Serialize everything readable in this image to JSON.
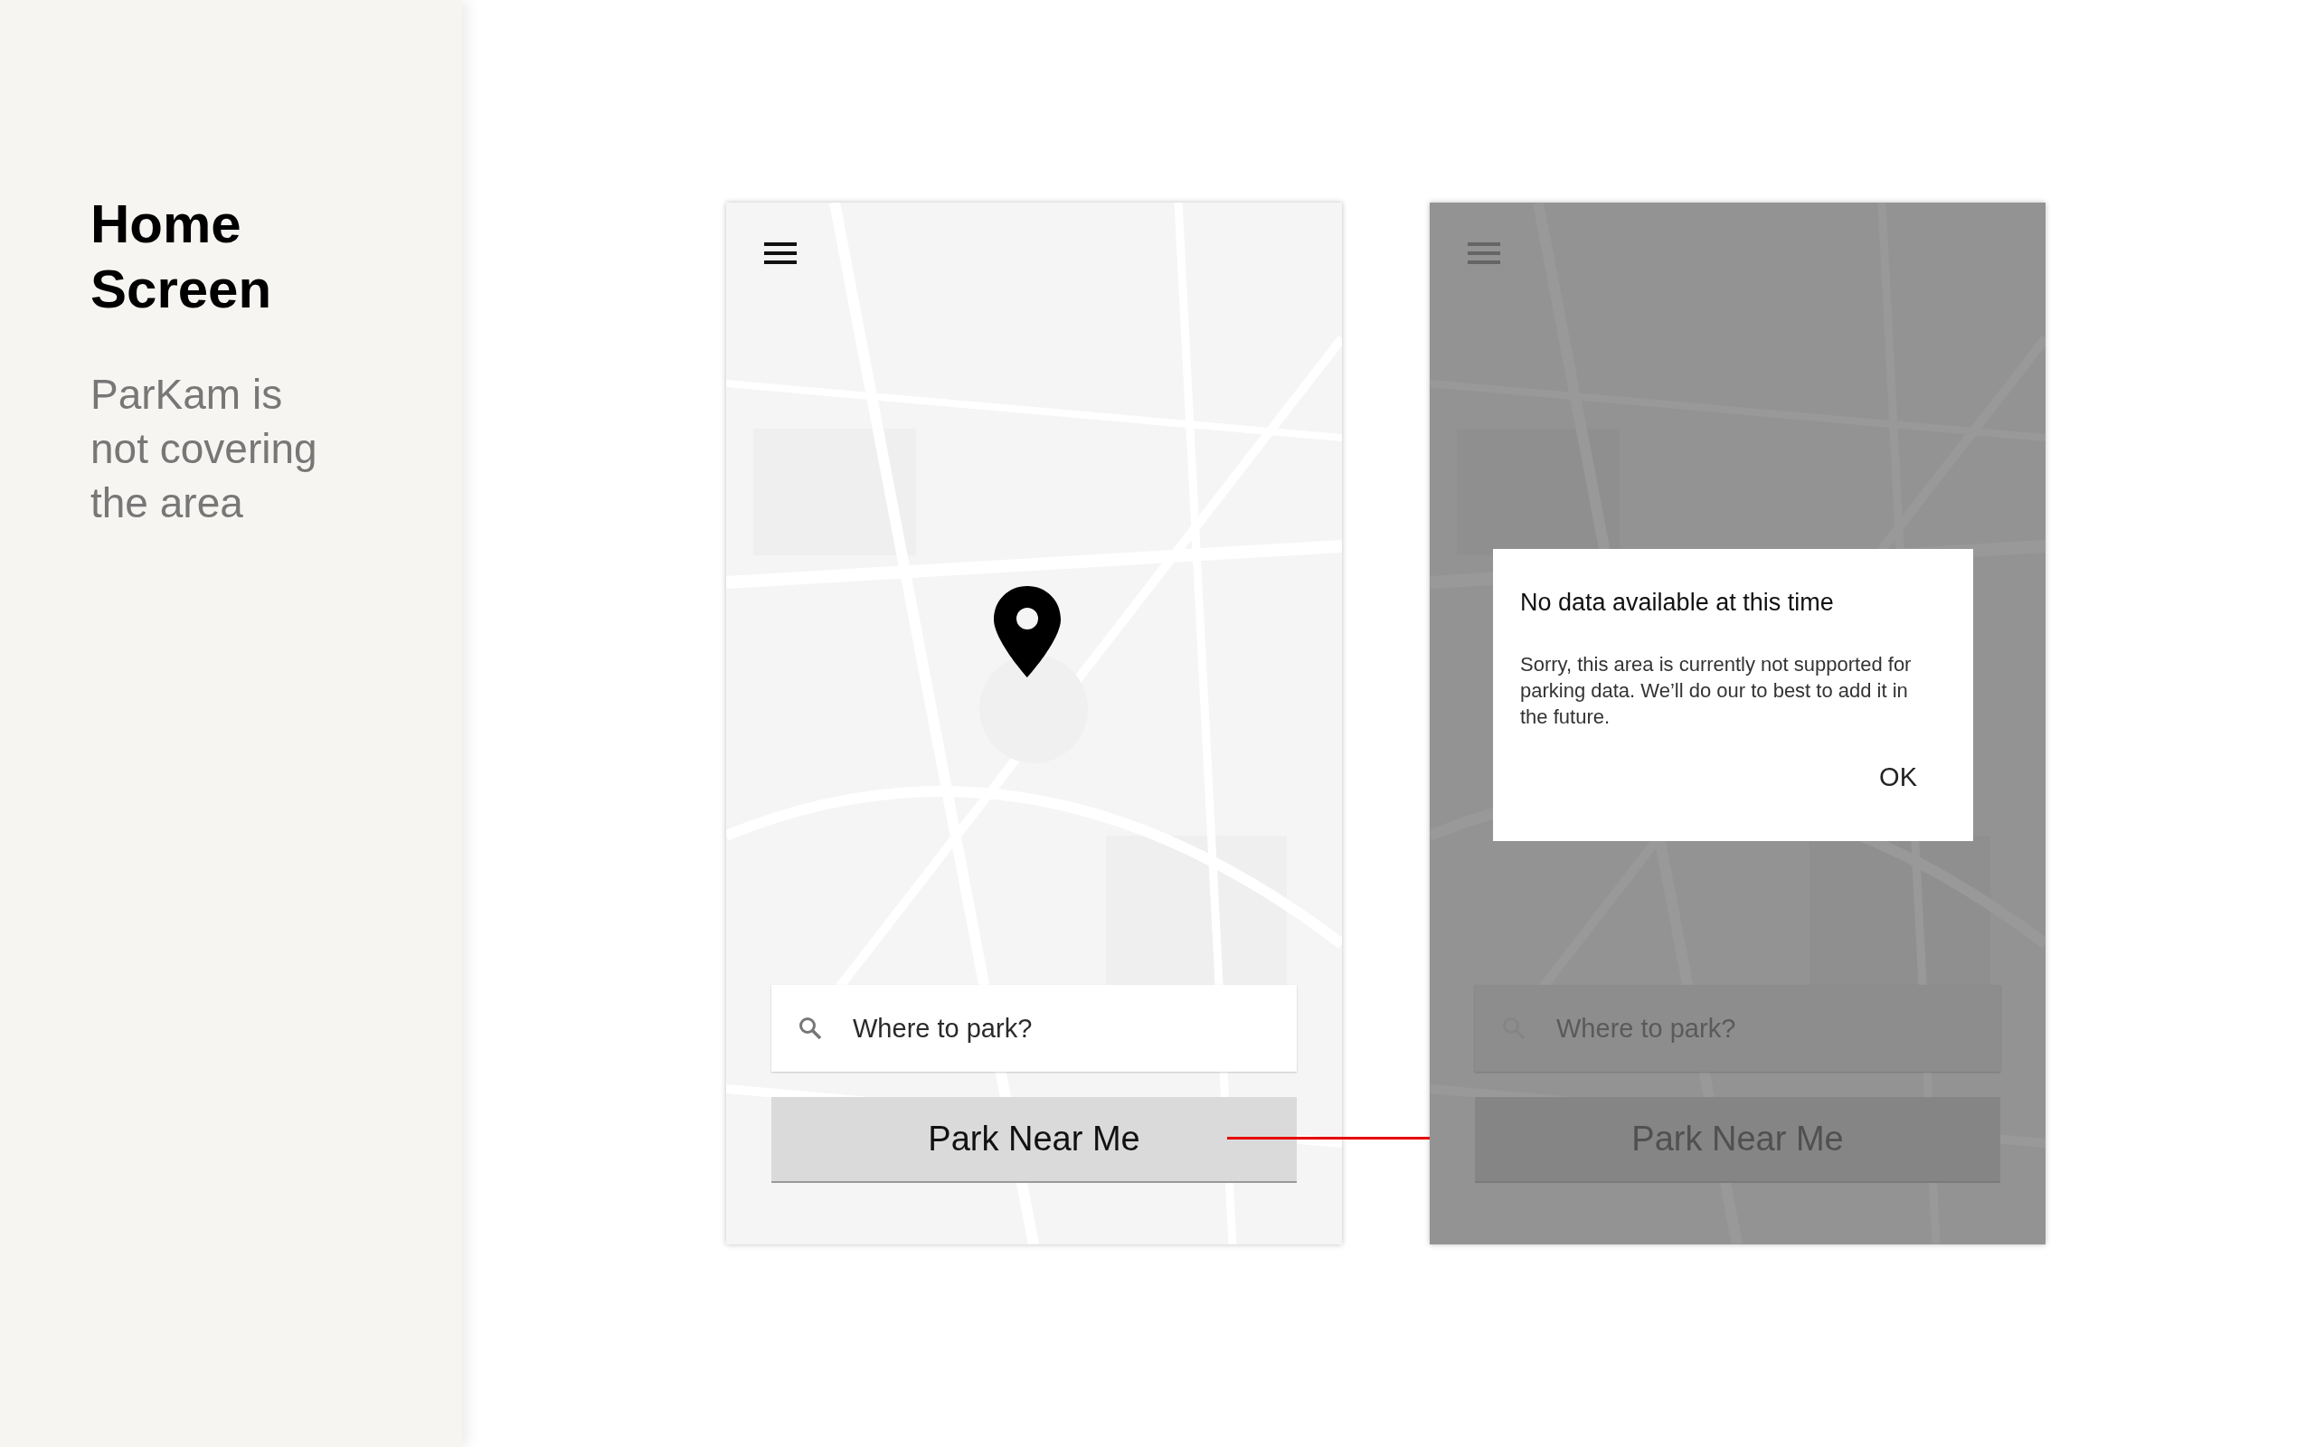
{
  "sidebar": {
    "title": "Home Screen",
    "description": "ParKam is not covering the area"
  },
  "screens": [
    {
      "dimmed": false,
      "search": {
        "placeholder": "Where to park?"
      },
      "button": "Park Near Me"
    },
    {
      "dimmed": true,
      "search": {
        "placeholder": "Where to park?"
      },
      "button": "Park Near Me",
      "dialog": {
        "title": "No data available at this time",
        "message": "Sorry, this area is currently not supported for parking data. We’ll do our to best to add it in the future.",
        "action": "OK"
      }
    }
  ]
}
